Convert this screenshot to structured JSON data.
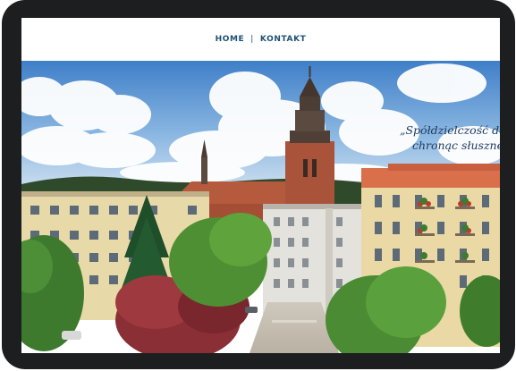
{
  "nav": {
    "items": [
      {
        "label": "HOME"
      },
      {
        "label": "KONTAKT"
      }
    ],
    "separator": "|"
  },
  "hero": {
    "tagline_line1": "„Spółdzielczość dow",
    "tagline_line2": "chronąc słuszne i"
  },
  "colors": {
    "nav_text": "#1e4f78",
    "tablet_frame": "#1d1e20",
    "sky": "#4f8fd0",
    "roof": "#b55a3c",
    "tagline": "#1e3a5e"
  }
}
